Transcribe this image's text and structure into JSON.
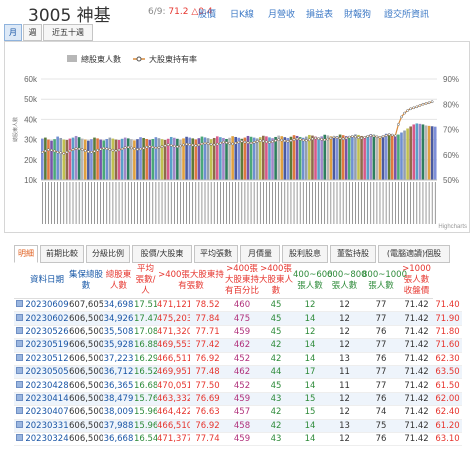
{
  "header": {
    "code_name": "3005 神基",
    "date": "6/9:",
    "price": "71.2",
    "change": "△0.4",
    "nav": [
      "股價",
      "日K線",
      "月營收",
      "損益表",
      "財報狗",
      "證交所資訊"
    ]
  },
  "period_tabs": [
    "月",
    "週",
    "近五十週"
  ],
  "chart_data": {
    "type": "bar",
    "legend": [
      "總股東人數",
      "大股東持有率"
    ],
    "y_left": [
      "60k",
      "50k",
      "40k",
      "30k",
      "20k",
      "10k"
    ],
    "y_left_range": [
      10000,
      60000
    ],
    "y_right": [
      "90%",
      "80%",
      "70%",
      "60%",
      "50%"
    ],
    "y_right_range": [
      50,
      90
    ],
    "y_left_label": "總股東人數",
    "credit": "Highcharts",
    "bar_colors": [
      "#7e8fd8",
      "#5c7a3a",
      "#e07840",
      "#7755a8",
      "#4aa878",
      "#6f8fd0",
      "#93a0ae",
      "#c0c050",
      "#8e6a4a",
      "#d65a8a",
      "#5aa0c8",
      "#a088c8",
      "#2e7e5e",
      "#b5b5b5",
      "#e0a040",
      "#4a5aa0"
    ],
    "series": [
      {
        "name": "總股東人數",
        "values": [
          30500,
          31000,
          30000,
          29500,
          30200,
          31500,
          30800,
          30000,
          29800,
          30500,
          31000,
          31800,
          31200,
          30500,
          30000,
          29500,
          30200,
          31000,
          30600,
          30000,
          29600,
          30300,
          31000,
          30500,
          30000,
          29800,
          30400,
          31000,
          30600,
          30200,
          29600,
          30200,
          31200,
          30800,
          30300,
          29900,
          30300,
          31200,
          30700,
          30200,
          29800,
          30400,
          31300,
          30900,
          30400,
          29900,
          30600,
          31400,
          31000,
          30600,
          30100,
          30700,
          31500,
          31100,
          30700,
          30200,
          30800,
          31600,
          31200,
          30800,
          30300,
          30900,
          31700,
          31300,
          30900,
          30400,
          31000,
          31800,
          31400,
          31000,
          30600,
          31200,
          31900,
          31600,
          31100,
          30700,
          31300,
          32000,
          31700,
          31200,
          30800,
          31400,
          32200,
          31800,
          31300,
          30900,
          31500,
          32300,
          32000,
          31500,
          31000,
          31600,
          32400,
          32100,
          31600,
          31100,
          31700,
          32500,
          32200,
          31700,
          31200,
          31800,
          32600,
          32300,
          31800,
          31300,
          31900,
          32700,
          32400,
          31900,
          31400,
          32000,
          32900,
          32600,
          32100,
          31600,
          32500,
          33500,
          34500,
          35500,
          36500,
          37500,
          38000,
          37800,
          37500,
          37000,
          36800,
          36600,
          36400
        ]
      },
      {
        "name": "大股東持有率",
        "values": [
          61,
          61.5,
          62,
          61.8,
          61.5,
          61,
          60.8,
          60.5,
          61,
          61.5,
          62,
          62.5,
          62.3,
          62,
          61.6,
          61.2,
          61,
          61.4,
          61.8,
          62.2,
          62.6,
          62.4,
          62.1,
          61.8,
          61.6,
          61.9,
          62.3,
          62.8,
          63,
          62.7,
          62.4,
          62.1,
          62.3,
          62.6,
          63,
          63.3,
          63,
          62.7,
          62.9,
          63.2,
          63.6,
          64,
          63.7,
          63.4,
          63.2,
          63.5,
          63.9,
          64.2,
          64,
          63.8,
          63.6,
          63.9,
          64.3,
          64.6,
          64.4,
          64.1,
          63.9,
          64.2,
          64.6,
          65,
          64.8,
          64.5,
          64.3,
          64.6,
          65,
          65.3,
          65,
          64.8,
          64.6,
          64.9,
          65.3,
          65.6,
          65.4,
          65.1,
          64.9,
          65.2,
          65.6,
          66,
          65.8,
          65.5,
          65.3,
          65.6,
          66,
          66.3,
          66.1,
          65.8,
          65.6,
          65.9,
          66.3,
          66.6,
          66.4,
          66.1,
          65.9,
          66.2,
          66.6,
          67,
          66.8,
          66.5,
          66.3,
          66.6,
          67,
          67.3,
          67.1,
          66.8,
          66.6,
          66.9,
          67.3,
          67.6,
          67.4,
          67.1,
          66.9,
          67.2,
          67.6,
          68,
          67.8,
          67.5,
          72,
          75,
          76.5,
          77.5,
          78.2,
          78.6,
          79,
          79.5,
          80,
          80.3,
          80.6,
          81
        ]
      }
    ]
  },
  "detail_tabs": [
    "明細",
    "前期比較",
    "分級比例",
    "股價/大股東",
    "平均張數",
    "月價量",
    "股利股息",
    "董監持股",
    "(電腦適讀)個股"
  ],
  "table": {
    "headers": [
      "資料日期",
      "集保總股數",
      "總股東人數",
      "平均張數/人",
      ">400張大股東持有張數",
      ">400張大股東持有百分比",
      ">400張大股東人數",
      "400~600張人數",
      "600~800張人數",
      "800~1000張人數",
      ">1000張人數",
      "收盤價"
    ],
    "rows": [
      [
        "20230609",
        "607,605",
        "34,698",
        "17.51",
        "471,121",
        "78.52",
        "460",
        "45",
        "12",
        "12",
        "77",
        "71.42",
        "71.40"
      ],
      [
        "20230602",
        "606,500",
        "34,926",
        "17.47",
        "475,203",
        "77.84",
        "475",
        "45",
        "14",
        "12",
        "77",
        "71.42",
        "71.90"
      ],
      [
        "20230526",
        "606,500",
        "35,508",
        "17.08",
        "471,320",
        "77.71",
        "459",
        "45",
        "12",
        "12",
        "76",
        "71.42",
        "71.80"
      ],
      [
        "20230519",
        "606,500",
        "35,928",
        "16.88",
        "469,553",
        "77.42",
        "462",
        "42",
        "14",
        "12",
        "77",
        "71.42",
        "71.60"
      ],
      [
        "20230512",
        "606,500",
        "37,223",
        "16.29",
        "466,511",
        "76.92",
        "452",
        "42",
        "14",
        "13",
        "76",
        "71.42",
        "62.30"
      ],
      [
        "20230505",
        "606,500",
        "36,712",
        "16.52",
        "469,951",
        "77.48",
        "462",
        "44",
        "17",
        "11",
        "77",
        "71.42",
        "63.50"
      ],
      [
        "20230428",
        "606,500",
        "36,365",
        "16.68",
        "470,051",
        "77.50",
        "452",
        "45",
        "14",
        "11",
        "77",
        "71.42",
        "61.50"
      ],
      [
        "20230414",
        "606,500",
        "38,479",
        "15.76",
        "463,332",
        "76.69",
        "459",
        "43",
        "15",
        "12",
        "76",
        "71.42",
        "62.00"
      ],
      [
        "20230407",
        "606,500",
        "38,009",
        "15.96",
        "464,422",
        "76.63",
        "457",
        "42",
        "15",
        "12",
        "74",
        "71.42",
        "62.40"
      ],
      [
        "20230331",
        "606,500",
        "37,988",
        "15.96",
        "466,510",
        "76.92",
        "458",
        "42",
        "14",
        "13",
        "75",
        "71.42",
        "61.20"
      ],
      [
        "20230324",
        "606,500",
        "36,668",
        "16.54",
        "471,377",
        "77.74",
        "459",
        "43",
        "14",
        "12",
        "76",
        "71.42",
        "63.10"
      ]
    ]
  }
}
